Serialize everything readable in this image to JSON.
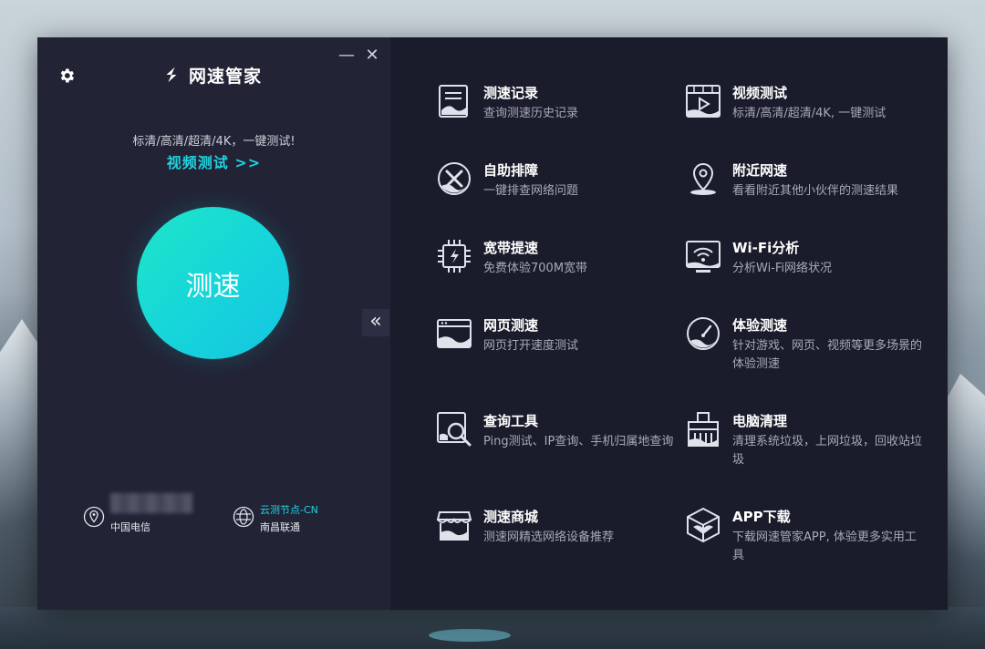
{
  "app": {
    "title": "网速管家"
  },
  "window_controls": {
    "minimize": "—",
    "close": "✕"
  },
  "left": {
    "tagline": "标清/高清/超清/4K，一键测试!",
    "video_link": "视频测试 >>",
    "speed_button": "测速",
    "isp": "中国电信",
    "node_name": "云测节点-CN",
    "node_isp": "南昌联通",
    "collapse": "«"
  },
  "features": [
    {
      "id": "records",
      "title": "测速记录",
      "desc": "查询测速历史记录",
      "icon": "document-list-icon"
    },
    {
      "id": "video",
      "title": "视频测试",
      "desc": "标清/高清/超清/4K, 一键测试",
      "icon": "video-play-icon"
    },
    {
      "id": "troubleshoot",
      "title": "自助排障",
      "desc": "一键排查网络问题",
      "icon": "wrench-tools-icon"
    },
    {
      "id": "nearby",
      "title": "附近网速",
      "desc": "看看附近其他小伙伴的测速结果",
      "icon": "location-pin-icon"
    },
    {
      "id": "boost",
      "title": "宽带提速",
      "desc": "免费体验700M宽带",
      "icon": "chip-lightning-icon"
    },
    {
      "id": "wifi",
      "title": "Wi-Fi分析",
      "desc": "分析Wi-Fi网络状况",
      "icon": "wifi-monitor-icon"
    },
    {
      "id": "webpage",
      "title": "网页测速",
      "desc": "网页打开速度测试",
      "icon": "browser-window-icon"
    },
    {
      "id": "experience",
      "title": "体验测速",
      "desc": "针对游戏、网页、视频等更多场景的体验测速",
      "icon": "speedometer-icon"
    },
    {
      "id": "tools",
      "title": "查询工具",
      "desc": "Ping测试、IP查询、手机归属地查询",
      "icon": "magnifier-icon"
    },
    {
      "id": "cleanup",
      "title": "电脑清理",
      "desc": "清理系统垃圾，上网垃圾，回收站垃圾",
      "icon": "broom-icon"
    },
    {
      "id": "store",
      "title": "测速商城",
      "desc": "测速网精选网络设备推荐",
      "icon": "store-icon"
    },
    {
      "id": "app",
      "title": "APP下载",
      "desc": "下载网速管家APP, 体验更多实用工具",
      "icon": "cube-download-icon"
    }
  ],
  "colors": {
    "accent": "#1fd3df",
    "left_bg": "#222436",
    "right_bg": "#1a1b2b"
  }
}
